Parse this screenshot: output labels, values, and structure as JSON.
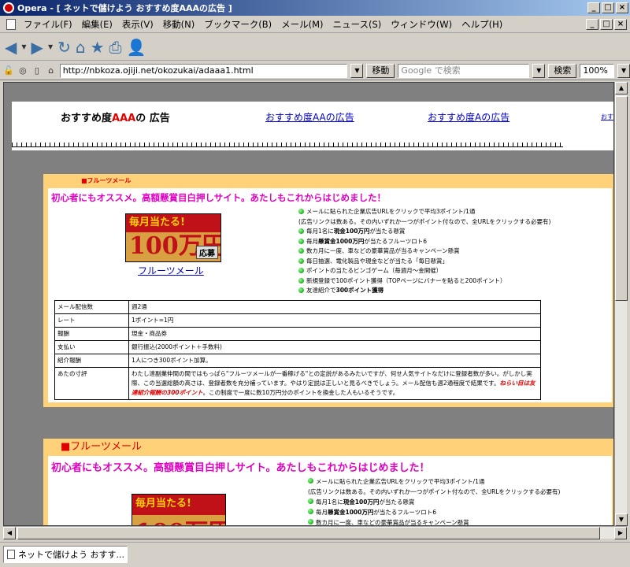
{
  "window": {
    "title": "Opera - [ ネットで儲けよう おすすめ度AAAの広告 ]",
    "buttons": [
      "_",
      "□",
      "×"
    ]
  },
  "menu": {
    "items": [
      "ファイル(F)",
      "編集(E)",
      "表示(V)",
      "移動(N)",
      "ブックマーク(B)",
      "メール(M)",
      "ニュース(S)",
      "ウィンドウ(W)",
      "ヘルプ(H)"
    ],
    "mdi_buttons": [
      "_",
      "□",
      "×"
    ]
  },
  "toolbar": {
    "back_icon": "◀",
    "forward_icon": "▶",
    "reload_icon": "↻",
    "home_icon": "⌂",
    "bookmark_icon": "★",
    "print_icon": "⎙",
    "user_icon": "👤"
  },
  "address": {
    "url": "http://nbkoza.ojiji.net/okozukai/adaaa1.html",
    "go_label": "移動",
    "search_placeholder": "Google で検索",
    "search_label": "検索",
    "zoom": "100%"
  },
  "page": {
    "header": {
      "title_prefix": "おすすめ度",
      "title_red": "AAA",
      "title_suffix": "の 広告",
      "links": [
        "おすすめ度AAの広告",
        "おすすめ度Aの広告",
        "おす"
      ]
    },
    "ads": [
      {
        "tab": "■フルーツメール",
        "headline": "初心者にもオススメ。高額懸賞目白押しサイト。あたしもこれからはじめました！",
        "banner": {
          "top": "毎月当たる!",
          "big": "100万円",
          "button": "応募"
        },
        "link": "フルーツメール",
        "features": [
          {
            "pre": "メールに貼られた企業広告URLをクリックで平均3ポイント/1通",
            "bold": "",
            "post": ""
          },
          {
            "pre": "(広告リンクは数ある。その内いずれか一つがポイント付なので、全URLをクリックする必要有)",
            "bold": "",
            "post": ""
          },
          {
            "pre": "毎月1名に",
            "bold": "現金100万円",
            "post": "が当たる懸賞"
          },
          {
            "pre": "毎月",
            "bold": "懸賞金1000万円",
            "post": "が当たるフルーツロト6"
          },
          {
            "pre": "数カ月に一度、車などの豪華賞品が当るキャンペーン懸賞",
            "bold": "",
            "post": ""
          },
          {
            "pre": "毎日抽選、電化製品や現金などが当たる「毎日懸賞」",
            "bold": "",
            "post": ""
          },
          {
            "pre": "ポイントの当たるビンゴゲーム（毎週月～金開催）",
            "bold": "",
            "post": ""
          },
          {
            "pre": "新規登録で100ポイント獲得（TOPページにバナーを貼ると200ポイント）",
            "bold": "",
            "post": ""
          },
          {
            "pre": "友達紹介で",
            "bold": "300ポイント獲得",
            "post": ""
          }
        ],
        "table": [
          {
            "k": "メール配信数",
            "v": "週2通"
          },
          {
            "k": "レート",
            "v": "1ポイント=1円"
          },
          {
            "k": "報酬",
            "v": "現金・商品券"
          },
          {
            "k": "支払い",
            "v": "銀行振込(2000ポイント＋手数料)"
          },
          {
            "k": "紹介報酬",
            "v": "1人につき300ポイント加算。"
          }
        ],
        "review_key": "あたの寸評",
        "review_1": "わたし達副業仲間の間ではもっぱら\"フルーツメールが一番稼げる\"との定説があるみたいですが、何せ人気サイトなだけに登録者数が多い。がしかし実際、この当選総額の高さは、登録者数を充分補っています。やはり定説は正しいと見るべきでしょう。メール配信も週2通程度で結果です。",
        "review_em": "ねらい目は友達紹介報酬の300ポイント",
        "review_2": "。この制度で一度に数10万円分のポイントを換金した人もいるそうです。"
      },
      {
        "tab": "■フルーツメール",
        "headline": "初心者にもオススメ。高額懸賞目白押しサイト。あたしもこれからはじめました！",
        "banner": {
          "top": "毎月当たる!",
          "big": "100万円",
          "button": "応募"
        },
        "features": [
          {
            "pre": "メールに貼られた企業広告URLをクリックで平均3ポイント/1通",
            "bold": "",
            "post": ""
          },
          {
            "pre": "(広告リンクは数ある。その内いずれか一つがポイント付なので、全URLをクリックする必要有)",
            "bold": "",
            "post": ""
          },
          {
            "pre": "毎月1名に",
            "bold": "現金100万円",
            "post": "が当たる懸賞"
          },
          {
            "pre": "毎月",
            "bold": "懸賞金1000万円",
            "post": "が当たるフルーツロト6"
          },
          {
            "pre": "数カ月に一度、車などの豪華賞品が当るキャンペーン懸賞",
            "bold": "",
            "post": ""
          }
        ]
      }
    ]
  },
  "status": {
    "tab_label": "ネットで儲けよう おすす..."
  }
}
